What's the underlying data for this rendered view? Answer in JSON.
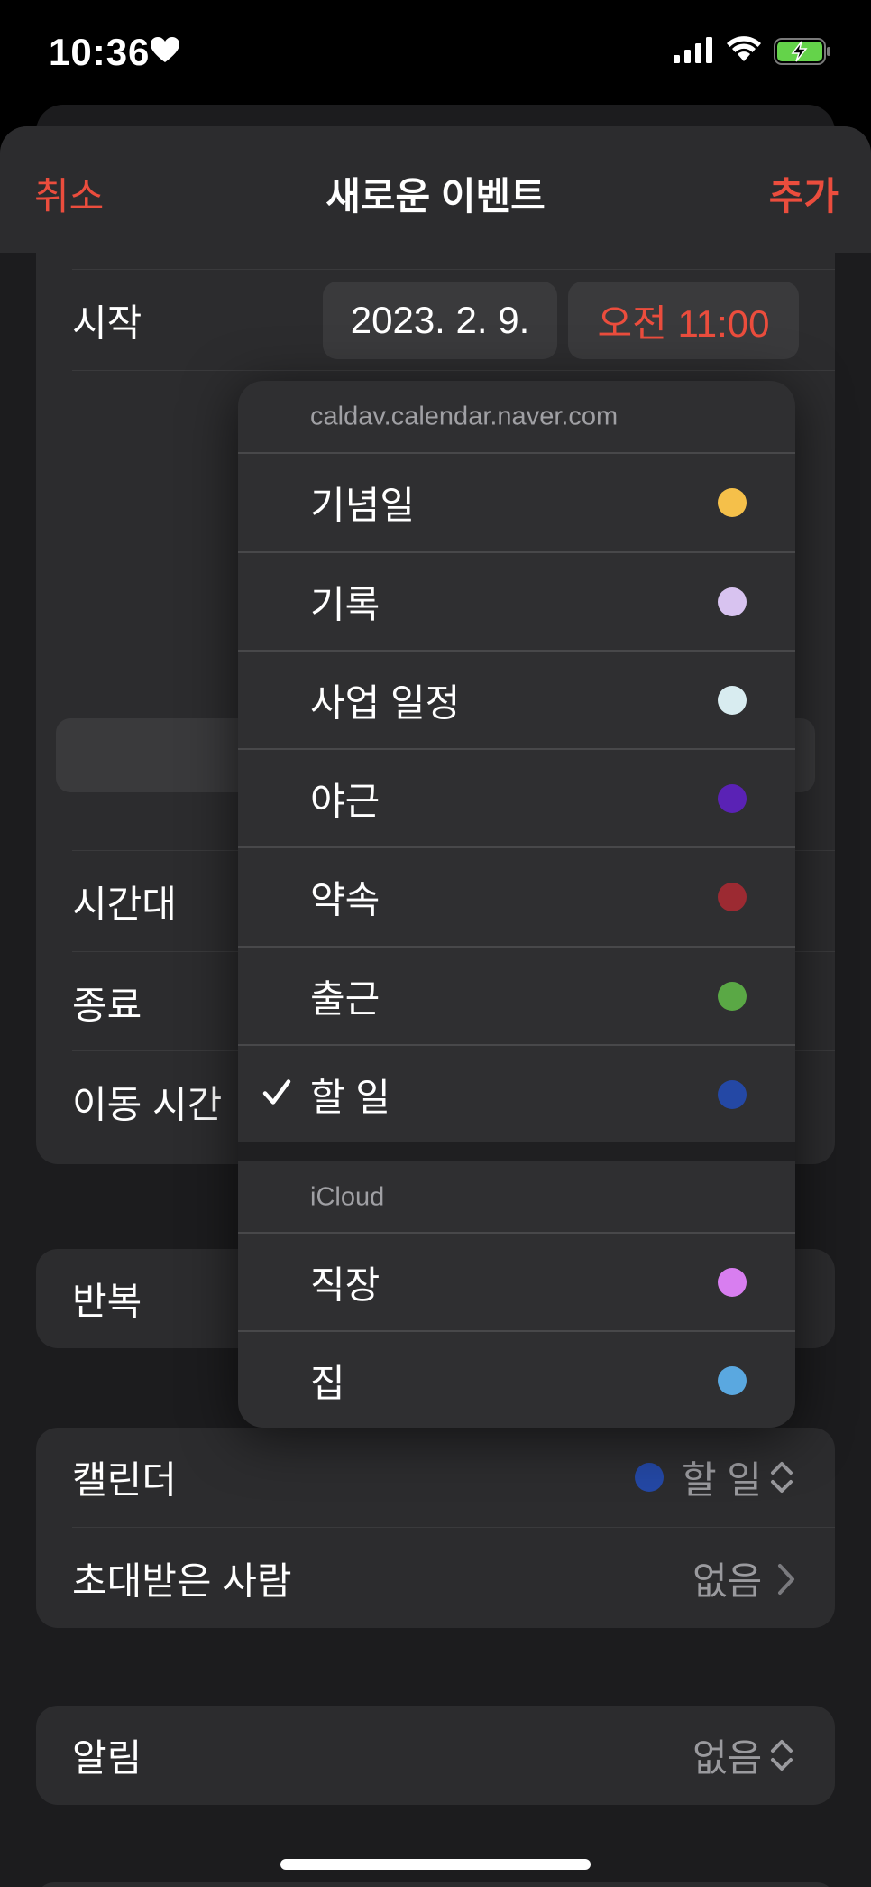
{
  "status": {
    "time": "10:36"
  },
  "header": {
    "cancel": "취소",
    "title": "새로운 이벤트",
    "add": "추가"
  },
  "event": {
    "start_label": "시작",
    "start_date": "2023. 2. 9.",
    "start_time": "오전 11:00",
    "timezone_label": "시간대",
    "end_label": "종료",
    "travel_label": "이동 시간",
    "repeat_label": "반복"
  },
  "calendar_row": {
    "label": "캘린더",
    "value": "할 일",
    "color": "#2448a5"
  },
  "invitees_row": {
    "label": "초대받은 사람",
    "value": "없음"
  },
  "alert_row": {
    "label": "알림",
    "value": "없음"
  },
  "menu": {
    "sections": [
      {
        "header": "caldav.calendar.naver.com",
        "items": [
          {
            "label": "기념일",
            "color": "#f5c04a",
            "checked": false
          },
          {
            "label": "기록",
            "color": "#d8c3f0",
            "checked": false
          },
          {
            "label": "사업 일정",
            "color": "#d8ecf0",
            "checked": false
          },
          {
            "label": "야근",
            "color": "#5a22b5",
            "checked": false
          },
          {
            "label": "약속",
            "color": "#9c2a32",
            "checked": false
          },
          {
            "label": "출근",
            "color": "#5aa845",
            "checked": false
          },
          {
            "label": "할 일",
            "color": "#2448a5",
            "checked": true
          }
        ]
      },
      {
        "header": "iCloud",
        "items": [
          {
            "label": "직장",
            "color": "#d87ef0",
            "checked": false
          },
          {
            "label": "집",
            "color": "#5aa8e0",
            "checked": false
          }
        ]
      }
    ]
  }
}
